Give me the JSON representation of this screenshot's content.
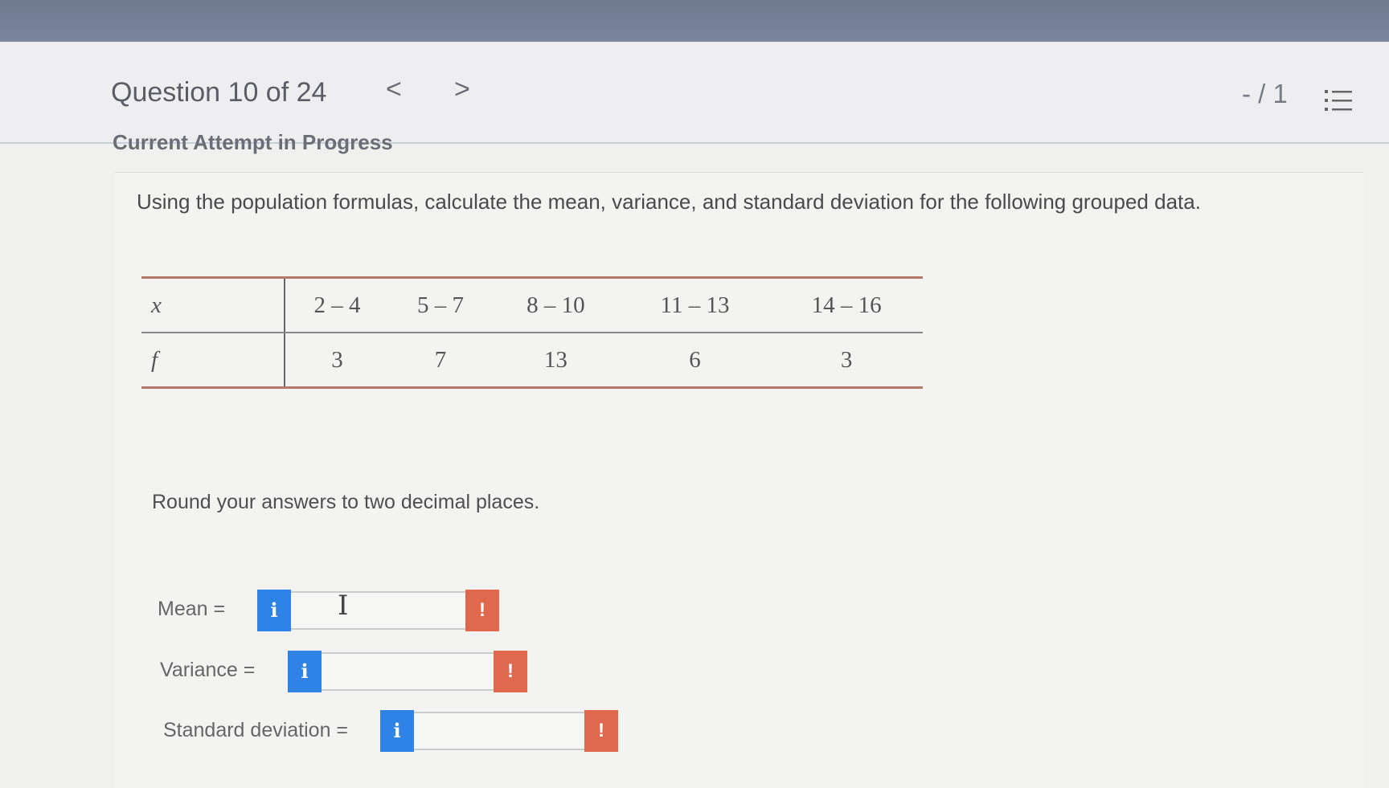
{
  "header": {
    "question_label": "Question 10 of 24",
    "prev_icon": "<",
    "next_icon": ">",
    "score": "- / 1",
    "list_icon": "question-list-icon"
  },
  "attempt_status": "Current Attempt in Progress",
  "question": {
    "prompt": "Using the population formulas, calculate the mean, variance, and standard deviation for the following grouped data.",
    "table": {
      "x_label": "x",
      "f_label": "f",
      "classes": [
        "2 – 4",
        "5 – 7",
        "8 – 10",
        "11 – 13",
        "14 – 16"
      ],
      "frequencies": [
        "3",
        "7",
        "13",
        "6",
        "3"
      ]
    },
    "instruction": "Round your answers to two decimal places."
  },
  "answers": {
    "mean": {
      "label": "Mean  =",
      "value": ""
    },
    "variance": {
      "label": "Variance  =",
      "value": ""
    },
    "std": {
      "label": "Standard deviation  =",
      "value": ""
    },
    "info_icon": "i",
    "warn_icon": "!"
  },
  "colors": {
    "info": "#2f83e6",
    "warning": "#e0684c",
    "table_rule": "#b5786b"
  }
}
